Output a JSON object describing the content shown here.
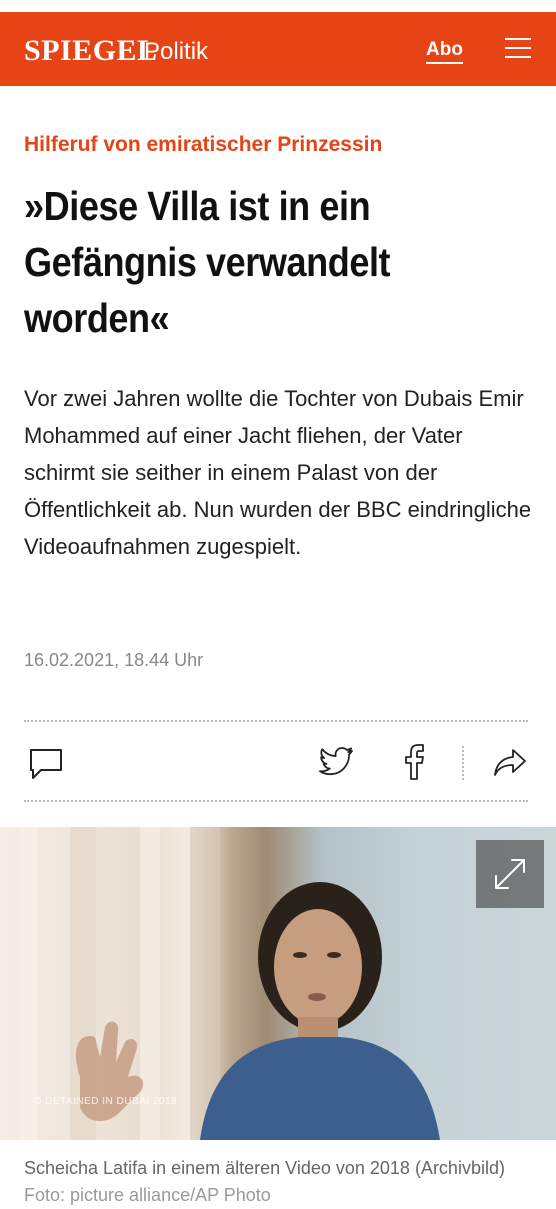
{
  "header": {
    "logo": "SPIEGEL",
    "section": "Politik",
    "abo_label": "Abo",
    "menu_icon": "hamburger-menu-icon"
  },
  "article": {
    "kicker": "Hilferuf von emiratischer Prinzessin",
    "headline": "»Diese Villa ist in ein Gefängnis verwandelt worden«",
    "teaser": "Vor zwei Jahren wollte die Tochter von Dubais Emir Mohammed auf einer Jacht fliehen, der Vater schirmt sie seither in einem Palast von der Öffentlichkeit ab. Nun wurden der BBC eindringliche Videoaufnahmen zugespielt.",
    "date": "16.02.2021, 18.44 Uhr"
  },
  "actions": {
    "comment_icon": "comment-icon",
    "twitter_icon": "twitter-icon",
    "facebook_icon": "facebook-icon",
    "share_icon": "share-icon"
  },
  "image": {
    "watermark": "© DETAINED IN DUBAI 2018",
    "expand_icon": "expand-icon",
    "caption": "Scheicha Latifa in einem älteren Video von 2018 (Archivbild)",
    "credit": "Foto: picture alliance/AP Photo"
  },
  "colors": {
    "brand": "#e64415",
    "headline": "#111111",
    "meta": "#888888"
  }
}
